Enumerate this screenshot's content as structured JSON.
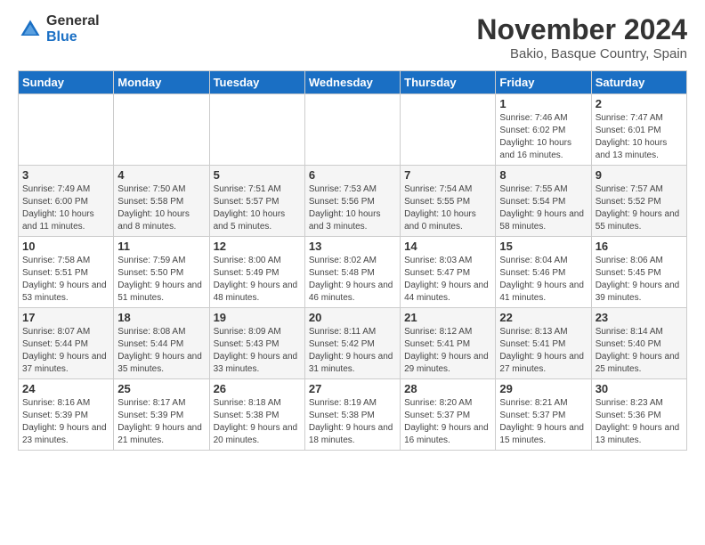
{
  "header": {
    "logo_general": "General",
    "logo_blue": "Blue",
    "month_title": "November 2024",
    "location": "Bakio, Basque Country, Spain"
  },
  "weekdays": [
    "Sunday",
    "Monday",
    "Tuesday",
    "Wednesday",
    "Thursday",
    "Friday",
    "Saturday"
  ],
  "weeks": [
    [
      {
        "day": "",
        "info": ""
      },
      {
        "day": "",
        "info": ""
      },
      {
        "day": "",
        "info": ""
      },
      {
        "day": "",
        "info": ""
      },
      {
        "day": "",
        "info": ""
      },
      {
        "day": "1",
        "info": "Sunrise: 7:46 AM\nSunset: 6:02 PM\nDaylight: 10 hours and 16 minutes."
      },
      {
        "day": "2",
        "info": "Sunrise: 7:47 AM\nSunset: 6:01 PM\nDaylight: 10 hours and 13 minutes."
      }
    ],
    [
      {
        "day": "3",
        "info": "Sunrise: 7:49 AM\nSunset: 6:00 PM\nDaylight: 10 hours and 11 minutes."
      },
      {
        "day": "4",
        "info": "Sunrise: 7:50 AM\nSunset: 5:58 PM\nDaylight: 10 hours and 8 minutes."
      },
      {
        "day": "5",
        "info": "Sunrise: 7:51 AM\nSunset: 5:57 PM\nDaylight: 10 hours and 5 minutes."
      },
      {
        "day": "6",
        "info": "Sunrise: 7:53 AM\nSunset: 5:56 PM\nDaylight: 10 hours and 3 minutes."
      },
      {
        "day": "7",
        "info": "Sunrise: 7:54 AM\nSunset: 5:55 PM\nDaylight: 10 hours and 0 minutes."
      },
      {
        "day": "8",
        "info": "Sunrise: 7:55 AM\nSunset: 5:54 PM\nDaylight: 9 hours and 58 minutes."
      },
      {
        "day": "9",
        "info": "Sunrise: 7:57 AM\nSunset: 5:52 PM\nDaylight: 9 hours and 55 minutes."
      }
    ],
    [
      {
        "day": "10",
        "info": "Sunrise: 7:58 AM\nSunset: 5:51 PM\nDaylight: 9 hours and 53 minutes."
      },
      {
        "day": "11",
        "info": "Sunrise: 7:59 AM\nSunset: 5:50 PM\nDaylight: 9 hours and 51 minutes."
      },
      {
        "day": "12",
        "info": "Sunrise: 8:00 AM\nSunset: 5:49 PM\nDaylight: 9 hours and 48 minutes."
      },
      {
        "day": "13",
        "info": "Sunrise: 8:02 AM\nSunset: 5:48 PM\nDaylight: 9 hours and 46 minutes."
      },
      {
        "day": "14",
        "info": "Sunrise: 8:03 AM\nSunset: 5:47 PM\nDaylight: 9 hours and 44 minutes."
      },
      {
        "day": "15",
        "info": "Sunrise: 8:04 AM\nSunset: 5:46 PM\nDaylight: 9 hours and 41 minutes."
      },
      {
        "day": "16",
        "info": "Sunrise: 8:06 AM\nSunset: 5:45 PM\nDaylight: 9 hours and 39 minutes."
      }
    ],
    [
      {
        "day": "17",
        "info": "Sunrise: 8:07 AM\nSunset: 5:44 PM\nDaylight: 9 hours and 37 minutes."
      },
      {
        "day": "18",
        "info": "Sunrise: 8:08 AM\nSunset: 5:44 PM\nDaylight: 9 hours and 35 minutes."
      },
      {
        "day": "19",
        "info": "Sunrise: 8:09 AM\nSunset: 5:43 PM\nDaylight: 9 hours and 33 minutes."
      },
      {
        "day": "20",
        "info": "Sunrise: 8:11 AM\nSunset: 5:42 PM\nDaylight: 9 hours and 31 minutes."
      },
      {
        "day": "21",
        "info": "Sunrise: 8:12 AM\nSunset: 5:41 PM\nDaylight: 9 hours and 29 minutes."
      },
      {
        "day": "22",
        "info": "Sunrise: 8:13 AM\nSunset: 5:41 PM\nDaylight: 9 hours and 27 minutes."
      },
      {
        "day": "23",
        "info": "Sunrise: 8:14 AM\nSunset: 5:40 PM\nDaylight: 9 hours and 25 minutes."
      }
    ],
    [
      {
        "day": "24",
        "info": "Sunrise: 8:16 AM\nSunset: 5:39 PM\nDaylight: 9 hours and 23 minutes."
      },
      {
        "day": "25",
        "info": "Sunrise: 8:17 AM\nSunset: 5:39 PM\nDaylight: 9 hours and 21 minutes."
      },
      {
        "day": "26",
        "info": "Sunrise: 8:18 AM\nSunset: 5:38 PM\nDaylight: 9 hours and 20 minutes."
      },
      {
        "day": "27",
        "info": "Sunrise: 8:19 AM\nSunset: 5:38 PM\nDaylight: 9 hours and 18 minutes."
      },
      {
        "day": "28",
        "info": "Sunrise: 8:20 AM\nSunset: 5:37 PM\nDaylight: 9 hours and 16 minutes."
      },
      {
        "day": "29",
        "info": "Sunrise: 8:21 AM\nSunset: 5:37 PM\nDaylight: 9 hours and 15 minutes."
      },
      {
        "day": "30",
        "info": "Sunrise: 8:23 AM\nSunset: 5:36 PM\nDaylight: 9 hours and 13 minutes."
      }
    ]
  ]
}
